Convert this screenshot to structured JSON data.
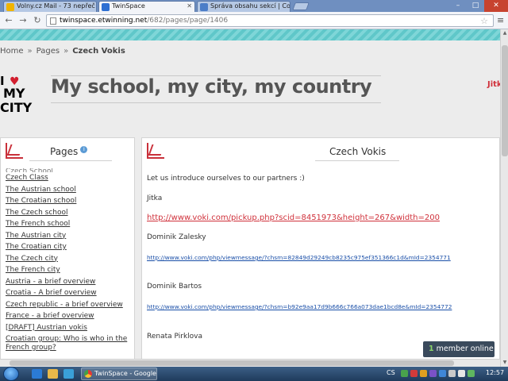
{
  "browser": {
    "tabs": [
      {
        "label": "Volny.cz Mail - 73 nepřeč",
        "color": "#f0b400"
      },
      {
        "label": "TwinSpace",
        "color": "#2d6fd2"
      },
      {
        "label": "Správa obsahu sekcí | Con",
        "color": "#4a7dc8"
      }
    ],
    "url_host": "twinspace.etwinning.net",
    "url_path": "/682/pages/page/1406"
  },
  "breadcrumb": {
    "home": "Home",
    "pages": "Pages",
    "current": "Czech Vokis"
  },
  "header": {
    "logo_line1": "I",
    "logo_line2": "MY",
    "logo_line3": "CITY",
    "title": "My school, my city, my country",
    "side_name": "Jitk"
  },
  "pages_panel": {
    "title": "Pages",
    "cut_item": "Czech School",
    "items": [
      "Czech Class",
      "The Austrian school",
      "The Croatian school",
      "The Czech school",
      "The French school",
      "The Austrian city",
      "The Croatian city",
      "The Czech city",
      "The French city",
      "Austria - a brief overview",
      "Croatia - A brief overview",
      "Czech republic - a brief overview",
      "France - a brief overview",
      "[DRAFT] Austrian vokis",
      "Croatian group: Who is who in the",
      "French group?"
    ]
  },
  "main_panel": {
    "title": "Czech Vokis",
    "intro": "Let us introduce ourselves to our partners :)",
    "entries": [
      {
        "name": "Jitka",
        "link": "http://www.voki.com/pickup.php?scid=8451973&height=267&width=200"
      },
      {
        "name": "Dominik Zalesky",
        "link": "http://www.voki.com/php/viewmessage/?chsm=82849d29249cb8235c975ef351366c1d&mId=2354771"
      },
      {
        "name": "Dominik Bartos",
        "link": "http://www.voki.com/php/viewmessage/?chsm=b92e9aa17d9b666c766a073dae1bcd8e&mId=2354772"
      },
      {
        "name": "Renata Pirklova",
        "link": ""
      }
    ]
  },
  "members": {
    "count": "1",
    "label": " member online"
  },
  "taskbar": {
    "task_label": "TwinSpace - Google...",
    "lang": "CS",
    "time": "12:57"
  }
}
